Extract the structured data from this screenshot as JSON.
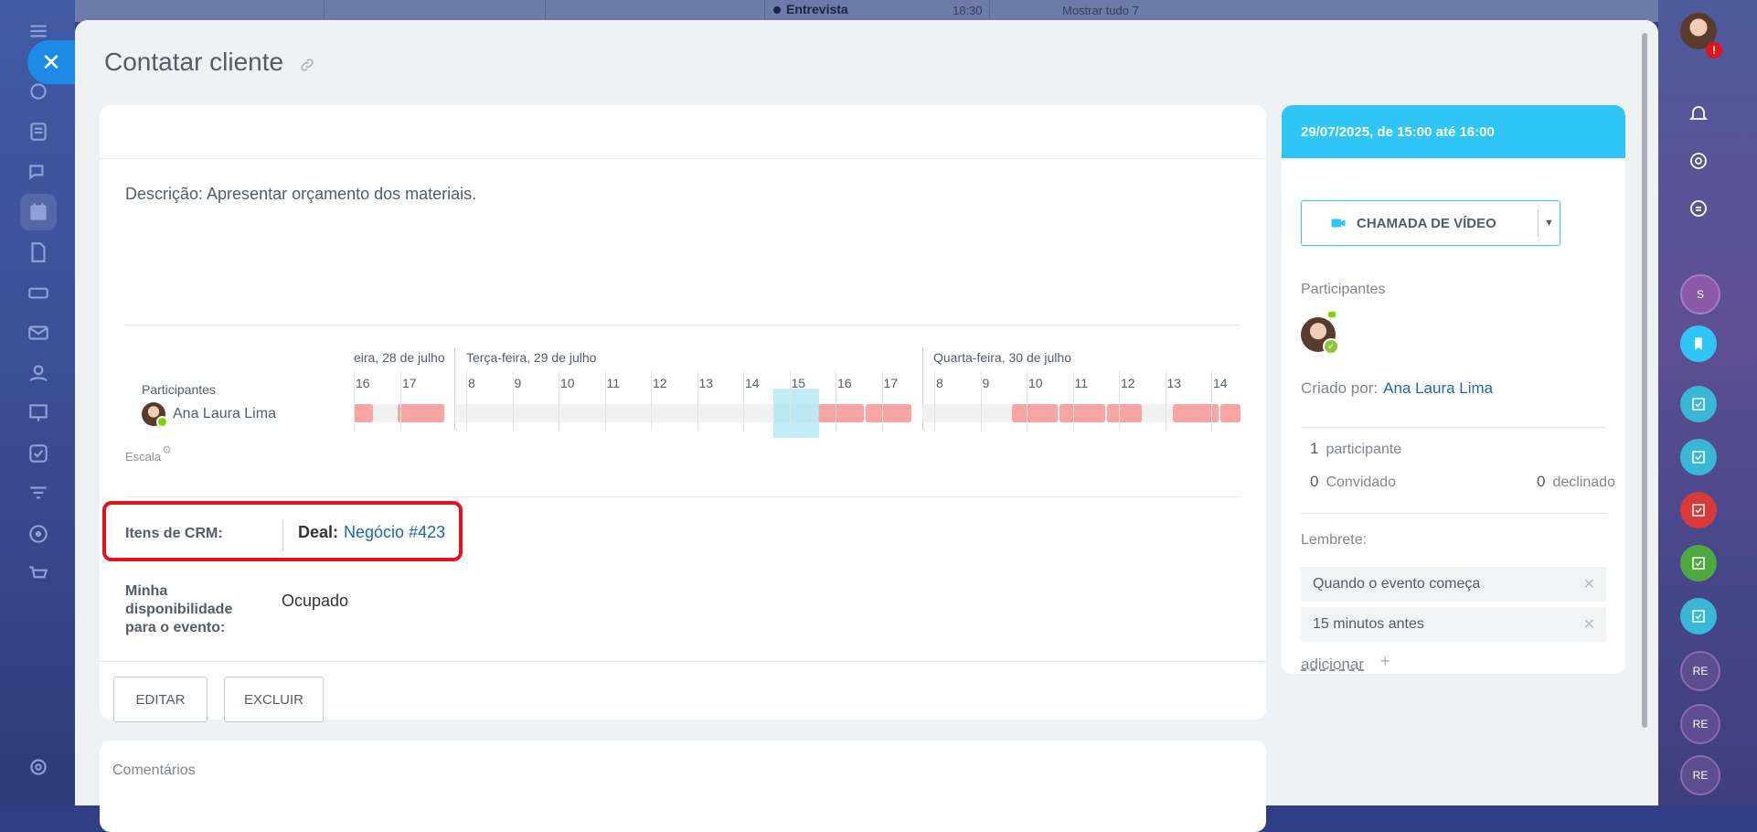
{
  "background_calendar": {
    "event_name": "Entrevista",
    "event_time": "18:30",
    "show_all": "Mostrar tudo 7"
  },
  "page": {
    "title": "Contatar cliente",
    "description": "Descrição: Apresentar orçamento dos materiais."
  },
  "scheduler": {
    "day_labels": [
      "eira, 28 de julho",
      "Terça-feira, 29 de julho",
      "Quarta-feira, 30 de julho"
    ],
    "hours_day1": [
      "16",
      "17"
    ],
    "hours_day2": [
      "8",
      "9",
      "10",
      "11",
      "12",
      "13",
      "14",
      "15",
      "16",
      "17"
    ],
    "hours_day3": [
      "8",
      "9",
      "10",
      "11",
      "12",
      "13",
      "14"
    ],
    "participants_label": "Participantes",
    "participant_name": "Ana Laura Lima",
    "scale_label": "Escala"
  },
  "crm": {
    "label": "Itens de CRM:",
    "deal_type": "Deal:",
    "deal_link": "Negócio #423"
  },
  "availability": {
    "label_line1": "Minha",
    "label_line2": "disponibilidade",
    "label_line3": "para o evento:",
    "value": "Ocupado"
  },
  "actions": {
    "edit": "EDITAR",
    "delete": "EXCLUIR"
  },
  "comments": {
    "label": "Comentários"
  },
  "side": {
    "date_range": "29/07/2025, de 15:00 até 16:00",
    "video_call": "CHAMADA DE VÍDEO",
    "participants_label": "Participantes",
    "created_by_label": "Criado por:",
    "created_by_name": "Ana Laura Lima",
    "participant_count": "1",
    "participant_word": "participante",
    "invited_count": "0",
    "invited_word": "Convidado",
    "declined_count": "0",
    "declined_word": "declinado",
    "reminder_label": "Lembrete:",
    "reminders": [
      "Quando o evento começa",
      "15 minutos antes"
    ],
    "add_reminder": "adicionar",
    "add_plus": "+"
  },
  "right_rail": {
    "badge_s": "S",
    "badge_re": "RE",
    "alert": "!"
  },
  "colors": {
    "accent_blue": "#2fc6f6",
    "link_blue": "#2067b0",
    "busy_red": "#f8a5a5",
    "highlight_red": "#e0141c",
    "close_button": "#1e8ae8"
  }
}
